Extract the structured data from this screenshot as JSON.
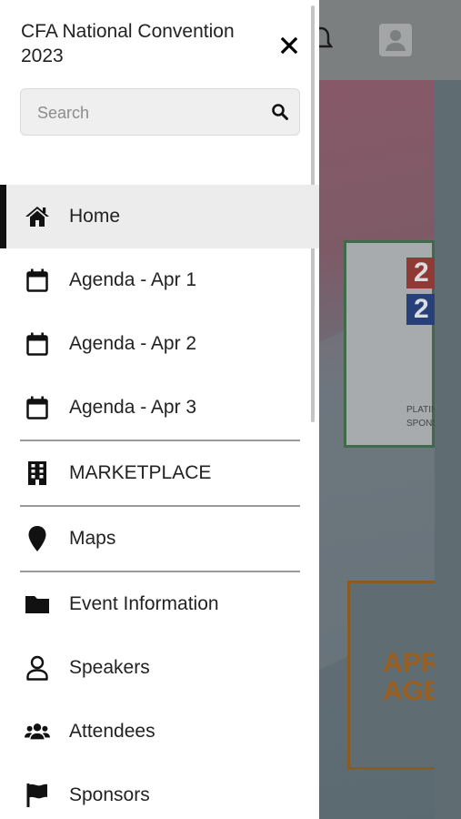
{
  "drawer": {
    "title": "CFA National Convention 2023",
    "search": {
      "placeholder": "Search",
      "value": ""
    },
    "items": [
      {
        "label": "Home",
        "icon": "home-icon",
        "active": true
      },
      {
        "label": "Agenda - Apr 1",
        "icon": "calendar-icon"
      },
      {
        "label": "Agenda - Apr 2",
        "icon": "calendar-icon"
      },
      {
        "label": "Agenda - Apr 3",
        "icon": "calendar-icon"
      },
      {
        "label": "MARKETPLACE",
        "icon": "building-icon"
      },
      {
        "label": "Maps",
        "icon": "map-pin-icon"
      },
      {
        "label": "Event Information",
        "icon": "folder-icon"
      },
      {
        "label": "Speakers",
        "icon": "person-icon"
      },
      {
        "label": "Attendees",
        "icon": "group-icon"
      },
      {
        "label": "Sponsors",
        "icon": "flag-icon"
      }
    ]
  },
  "background": {
    "card1": {
      "tile_top": "2",
      "tile_bottom": "2",
      "label": "PLATIN\nSPONS"
    },
    "card2": {
      "text": "APR\nAGE"
    }
  },
  "colors": {
    "accent": "#111111",
    "active_bg": "#ececec",
    "divider": "#9a9a9a"
  }
}
